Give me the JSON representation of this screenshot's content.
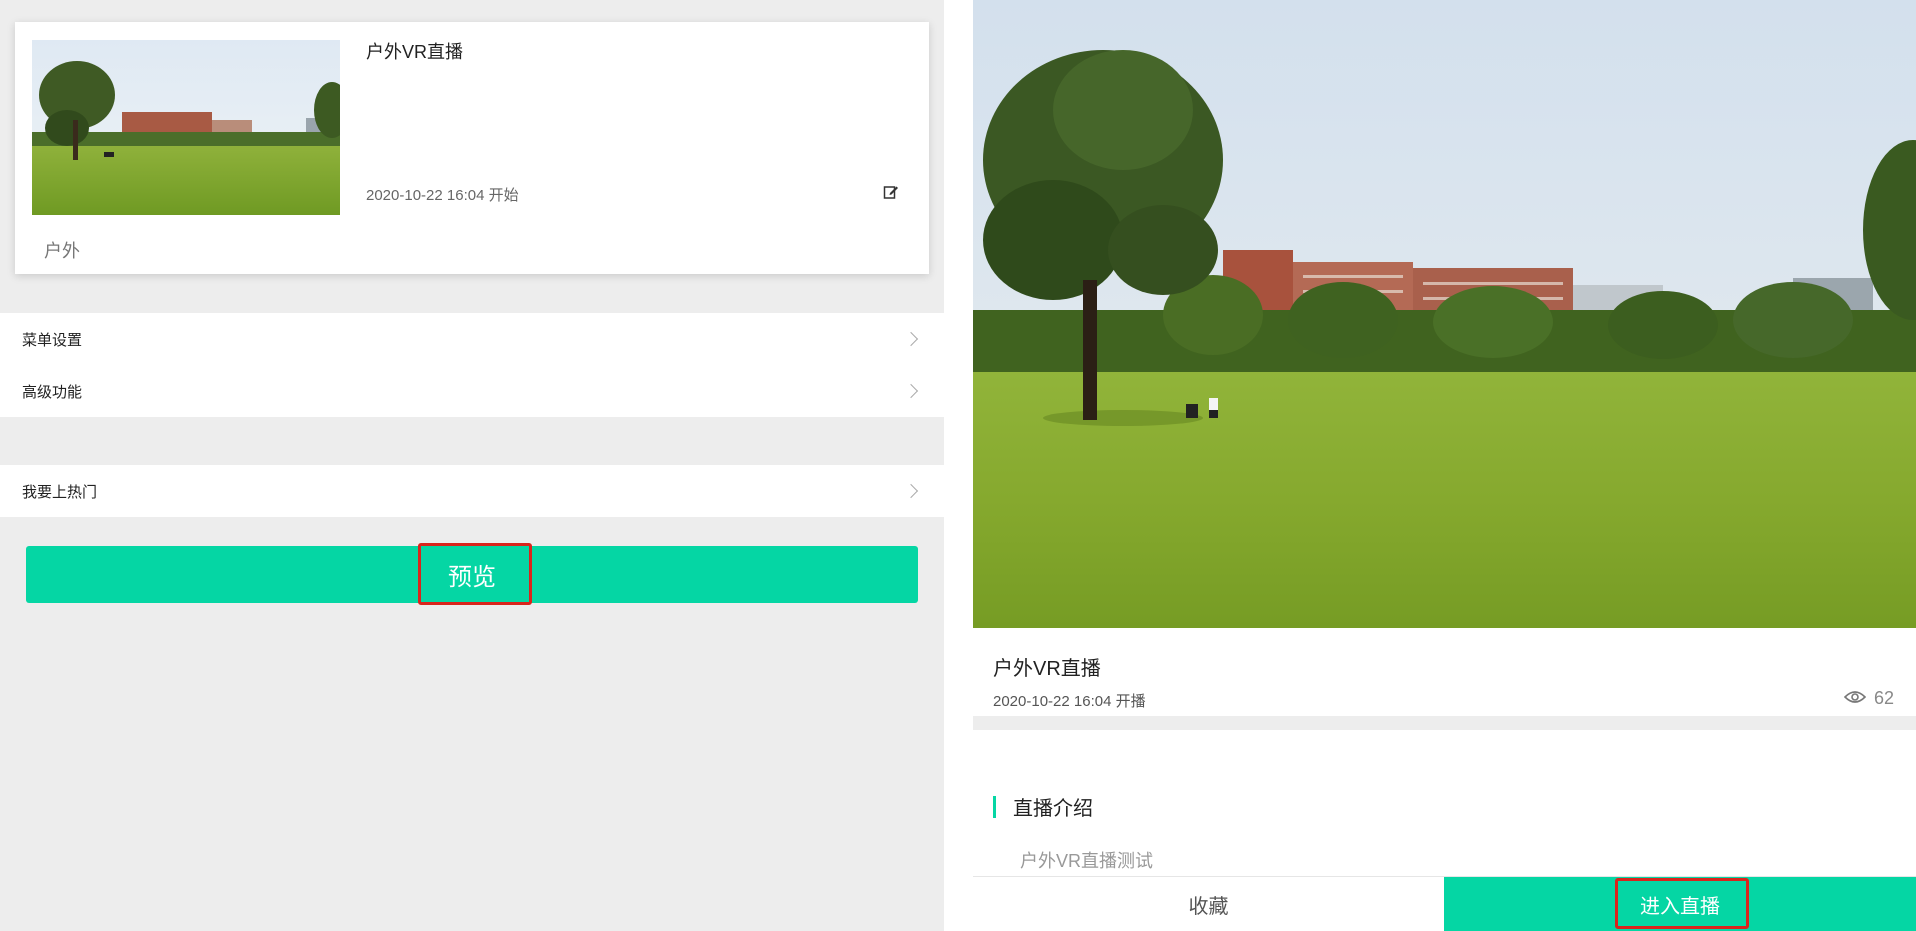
{
  "left": {
    "card": {
      "title": "户外VR直播",
      "date": "2020-10-22 16:04 开始",
      "tag": "户外"
    },
    "menu1": [
      {
        "label": "菜单设置"
      },
      {
        "label": "高级功能"
      }
    ],
    "menu2": [
      {
        "label": "我要上热门"
      }
    ],
    "preview_label": "预览"
  },
  "right": {
    "title": "户外VR直播",
    "date": "2020-10-22 16:04 开播",
    "views": "62",
    "section_title": "直播介绍",
    "section_body": "户外VR直播测试",
    "fav_label": "收藏",
    "enter_label": "进入直播"
  },
  "colors": {
    "accent": "#05d6a4",
    "highlight": "#d9241c",
    "bg_gray": "#ededed"
  },
  "icons": [
    "edit-icon",
    "chevron-right-icon",
    "eye-icon"
  ]
}
